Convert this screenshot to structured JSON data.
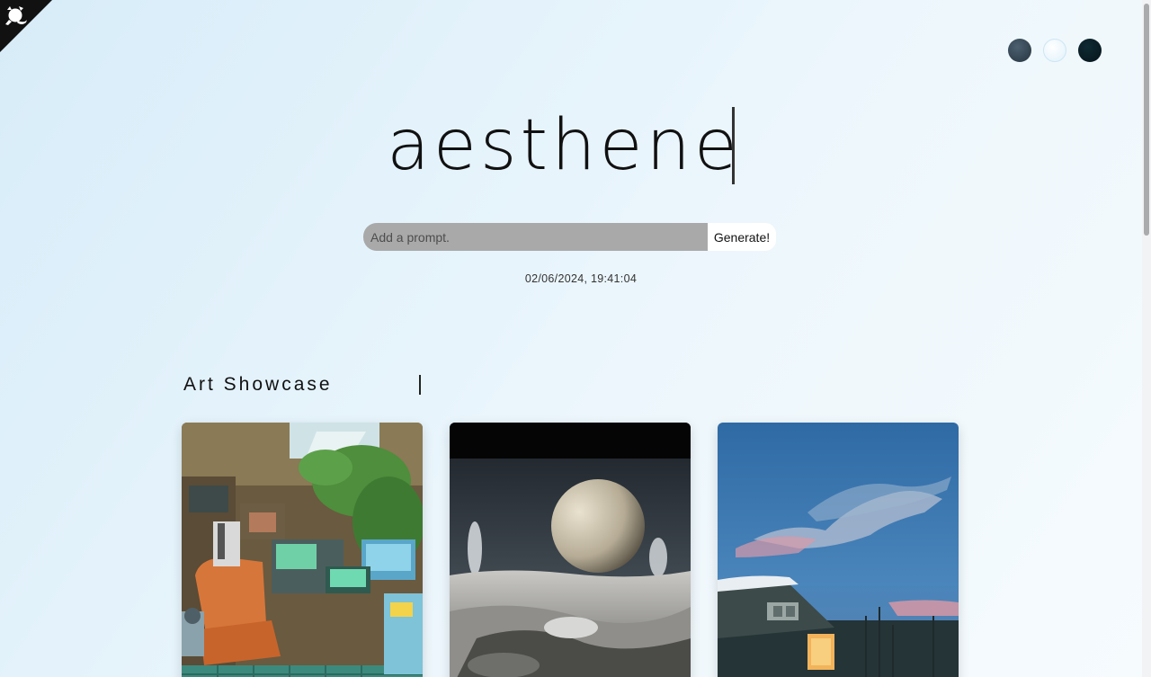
{
  "app": {
    "title": "aesthene"
  },
  "prompt": {
    "placeholder": "Add a prompt.",
    "value": "",
    "generate_label": "Generate!"
  },
  "timestamp": "02/06/2024, 19:41:04",
  "theme_options": [
    {
      "name": "slate",
      "color": "#2f3f4b"
    },
    {
      "name": "light",
      "color": "#eaf6fc"
    },
    {
      "name": "dark",
      "color": "#0a1e25"
    }
  ],
  "showcase": {
    "title": "Art Showcase",
    "items": [
      {
        "name": "cyberpunk-workshop-room",
        "colors": [
          "#c8743e",
          "#3f8f5c",
          "#4aa9c9"
        ]
      },
      {
        "name": "moon-over-icy-landscape",
        "colors": [
          "#101418",
          "#d9d4c8",
          "#6d7c88"
        ]
      },
      {
        "name": "winter-cabin-at-dusk",
        "colors": [
          "#3a76b2",
          "#e07a8a",
          "#2a3b3c"
        ]
      }
    ]
  },
  "corner_icon": "github-octocat-icon"
}
